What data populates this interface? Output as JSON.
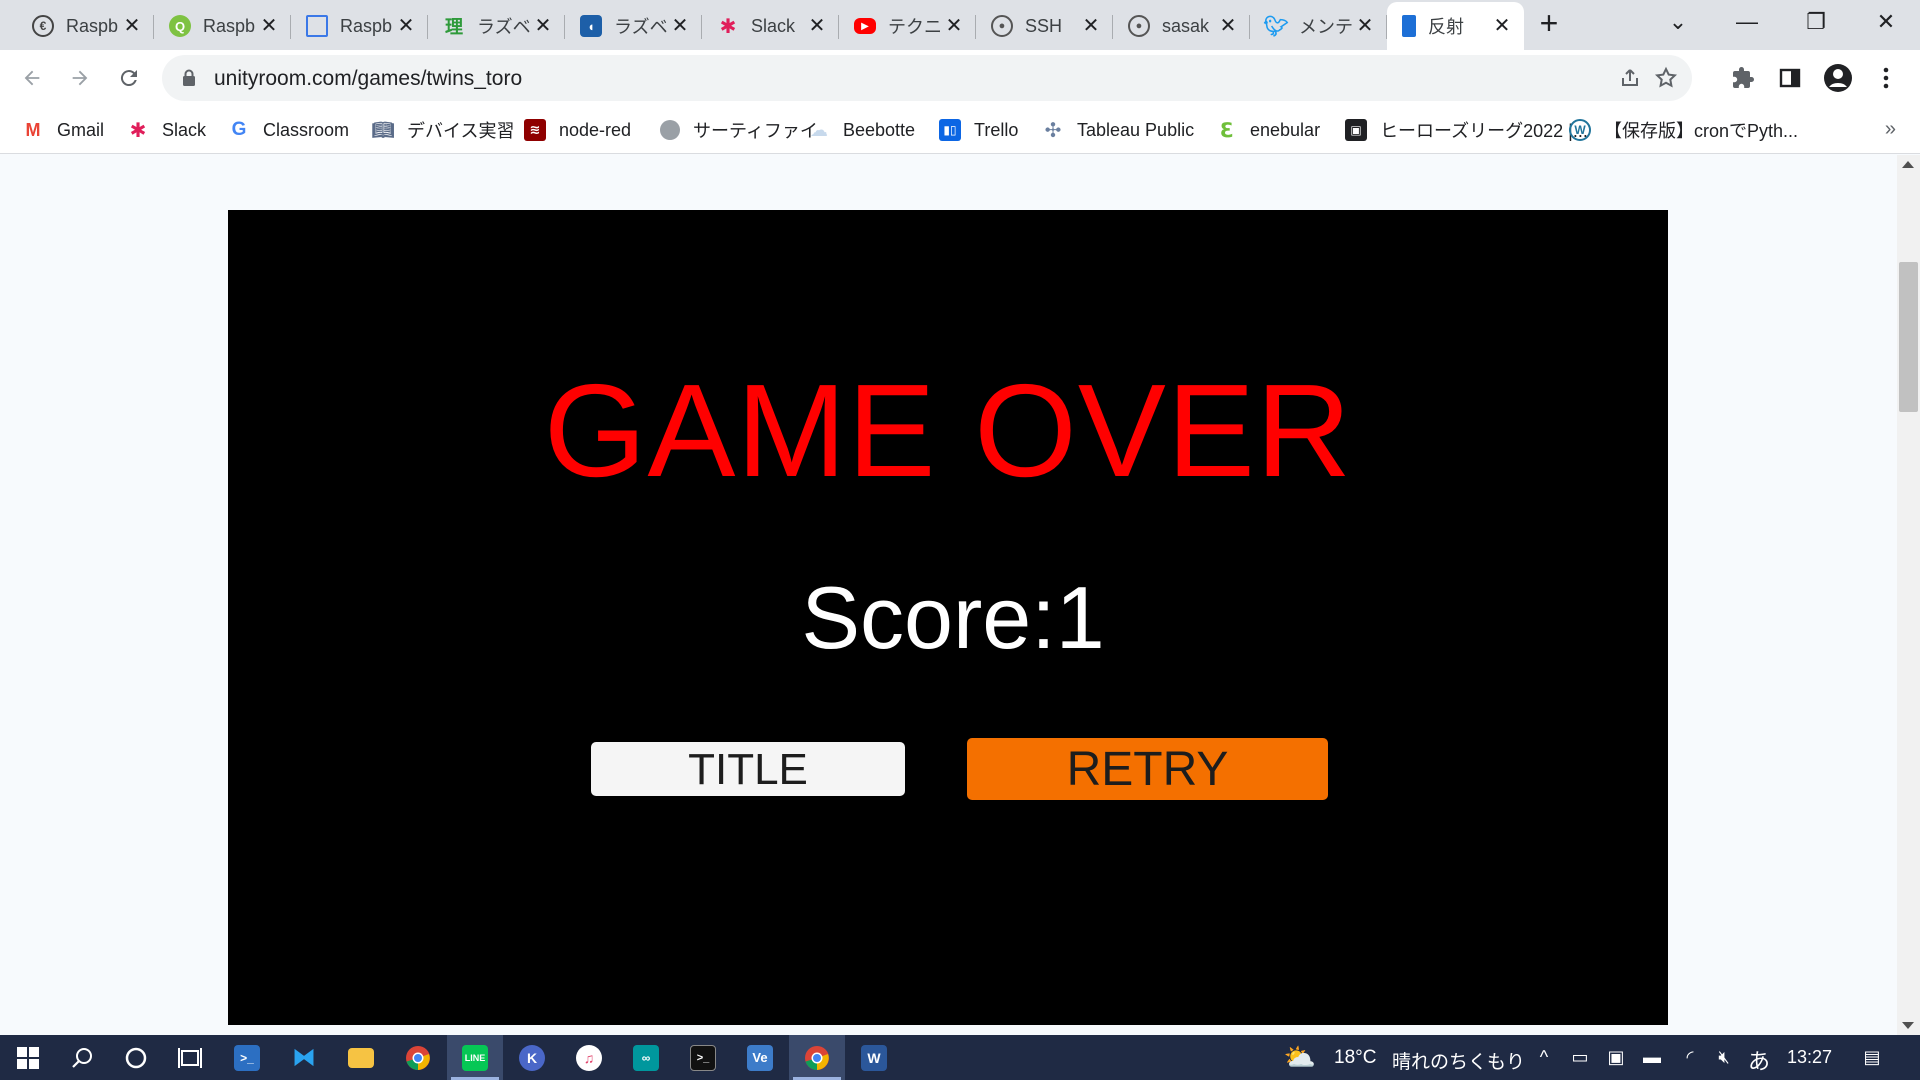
{
  "browser": {
    "tabs": [
      {
        "title": "Raspb",
        "icon": "raspberry-pi-circle-icon",
        "active": false
      },
      {
        "title": "Raspb",
        "icon": "green-q-icon",
        "active": false
      },
      {
        "title": "Raspb",
        "icon": "window-layout-icon",
        "active": false
      },
      {
        "title": "ラズベ",
        "icon": "kanji-ri-icon",
        "active": false
      },
      {
        "title": "ラズベ",
        "icon": "blue-drop-icon",
        "active": false
      },
      {
        "title": "Slack",
        "icon": "slack-icon",
        "active": false
      },
      {
        "title": "テクニ",
        "icon": "youtube-icon",
        "active": false
      },
      {
        "title": "SSH",
        "icon": "github-icon",
        "active": false
      },
      {
        "title": "sasak",
        "icon": "github-icon",
        "active": false
      },
      {
        "title": "メンテ",
        "icon": "twitter-icon",
        "active": false
      },
      {
        "title": "反射",
        "icon": "unityroom-icon",
        "active": true
      }
    ],
    "url": "unityroom.com/games/twins_toro",
    "bookmarks": [
      {
        "label": "Gmail",
        "icon": "gmail-icon"
      },
      {
        "label": "Slack",
        "icon": "slack-icon"
      },
      {
        "label": "Classroom",
        "icon": "google-g-icon"
      },
      {
        "label": "デバイス実習",
        "icon": "book-icon"
      },
      {
        "label": "node-red",
        "icon": "node-red-icon"
      },
      {
        "label": "サーティファイ",
        "icon": "globe-icon"
      },
      {
        "label": "Beebotte",
        "icon": "cloud-icon"
      },
      {
        "label": "Trello",
        "icon": "trello-icon"
      },
      {
        "label": "Tableau Public",
        "icon": "tableau-icon"
      },
      {
        "label": "enebular",
        "icon": "enebular-icon"
      },
      {
        "label": "ヒーローズリーグ2022 |...",
        "icon": "bookmark-page-icon"
      },
      {
        "label": "【保存版】cronでPyth...",
        "icon": "wordpress-icon"
      }
    ],
    "more_bookmarks": "»"
  },
  "game": {
    "title": "GAME OVER",
    "score_text": "Score:1",
    "title_button": "TITLE",
    "retry_button": "RETRY",
    "colors": {
      "background": "#000000",
      "game_over": "#ff0000",
      "score": "#ffffff",
      "title_button": "#f5f5f5",
      "retry_button": "#f47000"
    }
  },
  "taskbar": {
    "weather_temp": "18°C",
    "weather_text": "晴れのちくもり",
    "ime": "あ",
    "clock": "13:27"
  }
}
